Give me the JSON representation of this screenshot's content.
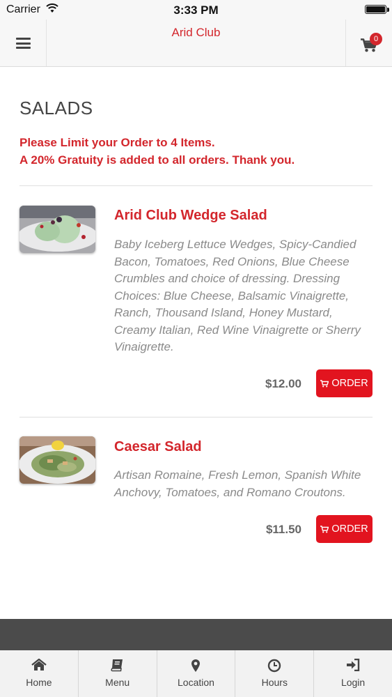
{
  "status_bar": {
    "carrier": "Carrier",
    "time": "3:33 PM"
  },
  "header": {
    "title": "Arid Club",
    "cart_count": "0"
  },
  "section": {
    "title": "SALADS",
    "notice_line1": "Please Limit your Order to 4 Items.",
    "notice_line2": "A 20% Gratuity is added to all orders. Thank you."
  },
  "items": [
    {
      "name": "Arid Club Wedge Salad",
      "description": "Baby Iceberg Lettuce Wedges, Spicy-Candied Bacon, Tomatoes, Red Onions, Blue Cheese Crumbles and choice of dressing. Dressing Choices: Blue Cheese, Balsamic Vinaigrette, Ranch, Thousand Island, Honey Mustard, Creamy Italian, Red Wine Vinaigrette or Sherry Vinaigrette.",
      "price": "$12.00",
      "order_label": "ORDER"
    },
    {
      "name": "Caesar Salad",
      "description": "Artisan Romaine, Fresh Lemon, Spanish White Anchovy, Tomatoes, and Romano Croutons.",
      "price": "$11.50",
      "order_label": "ORDER"
    }
  ],
  "tabs": [
    {
      "label": "Home",
      "icon": "home-icon"
    },
    {
      "label": "Menu",
      "icon": "book-icon"
    },
    {
      "label": "Location",
      "icon": "map-marker-icon"
    },
    {
      "label": "Hours",
      "icon": "clock-icon"
    },
    {
      "label": "Login",
      "icon": "sign-in-icon"
    }
  ],
  "colors": {
    "brand_red": "#d3262c",
    "button_red": "#e2141f",
    "footer_dark": "#4b4b4b"
  }
}
